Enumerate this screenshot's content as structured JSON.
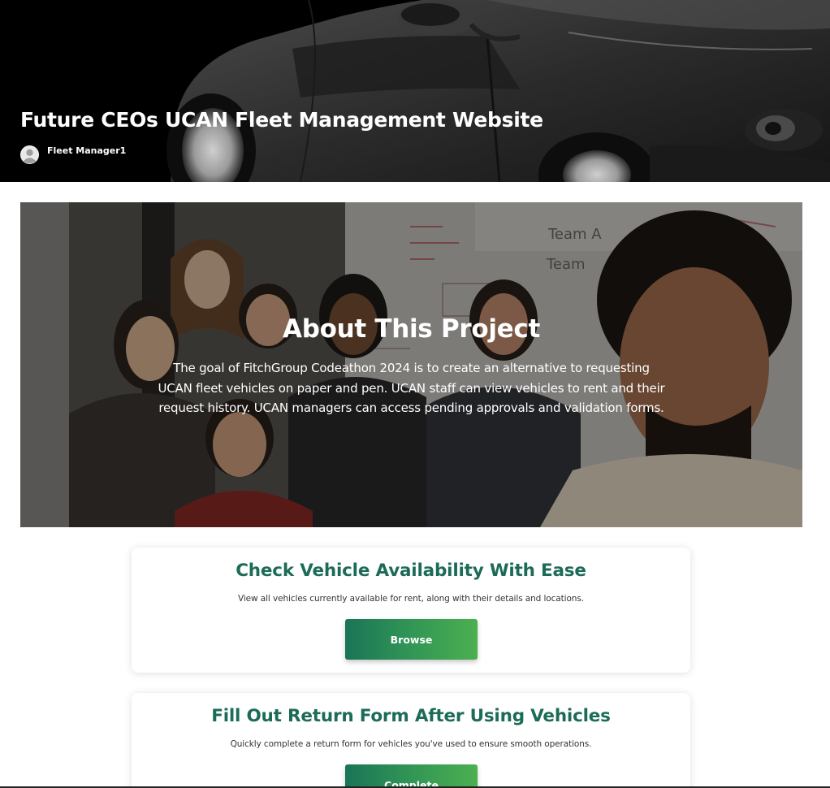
{
  "header": {
    "title": "Future CEOs UCAN Fleet Management Website",
    "user_name": "Fleet Manager1",
    "avatar_icon": "user-avatar-icon"
  },
  "about": {
    "title": "About This Project",
    "text": "The goal of FitchGroup Codeathon 2024 is to create an alternative to requesting UCAN fleet vehicles on paper and pen. UCAN staff can view vehicles to rent and their request history. UCAN managers can access pending approvals and validation forms.",
    "whiteboard_text": [
      "Team A",
      "Team"
    ]
  },
  "cards": [
    {
      "title": "Check Vehicle Availability With Ease",
      "description": "View all vehicles currently available for rent, along with their details and locations.",
      "button_label": "Browse"
    },
    {
      "title": "Fill Out Return Form After Using Vehicles",
      "description": "Quickly complete a return form for vehicles you've used to ensure smooth operations.",
      "button_label": "Complete"
    }
  ],
  "colors": {
    "accent": "#1c6b58",
    "button_gradient_start": "#1a7456",
    "button_gradient_end": "#4caf50",
    "header_bg": "#000000"
  }
}
